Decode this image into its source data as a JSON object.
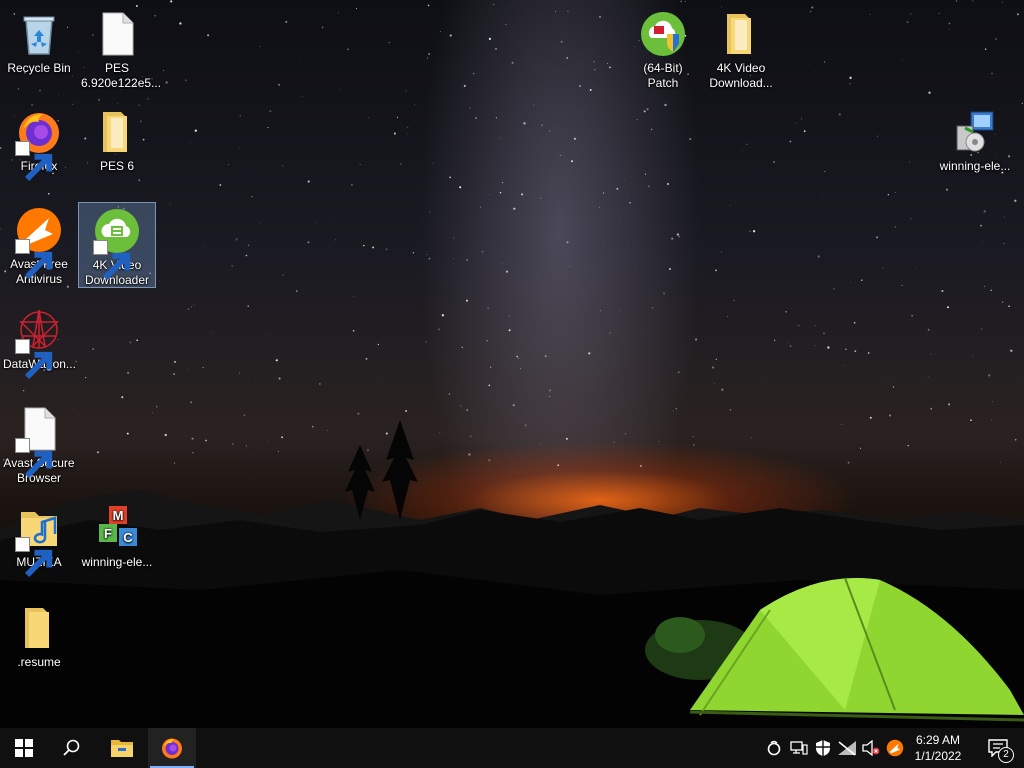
{
  "desktop": {
    "icons": [
      {
        "id": "recycle-bin",
        "label": "Recycle Bin",
        "icon": "recycle-bin-icon"
      },
      {
        "id": "pes-file",
        "label": "PES 6.920e122e5...",
        "icon": "blank-file-icon"
      },
      {
        "id": "firefox",
        "label": "Firefox",
        "icon": "firefox-icon"
      },
      {
        "id": "pes6-folder",
        "label": "PES 6",
        "icon": "folder-icon"
      },
      {
        "id": "avast-antivirus",
        "label": "Avast Free Antivirus",
        "icon": "avast-icon"
      },
      {
        "id": "4k-downloader",
        "label": "4K Video Downloader",
        "icon": "4k-downloader-icon",
        "selected": true
      },
      {
        "id": "datawagon",
        "label": "DataWagon...",
        "icon": "datawagon-icon"
      },
      {
        "id": "avast-browser",
        "label": "Avast Secure Browser",
        "icon": "blank-file-icon"
      },
      {
        "id": "muzika",
        "label": "MUZIKA",
        "icon": "music-folder-icon"
      },
      {
        "id": "winning-eleven-1",
        "label": "winning-ele...",
        "icon": "mfc-blocks-icon"
      },
      {
        "id": "resume",
        "label": ".resume",
        "icon": "folder-icon"
      },
      {
        "id": "patch-64bit",
        "label": "(64-Bit) Patch",
        "icon": "patch-icon"
      },
      {
        "id": "4k-folder",
        "label": "4K Video Download...",
        "icon": "folder-icon"
      },
      {
        "id": "winning-eleven-2",
        "label": "winning-ele...",
        "icon": "installer-icon"
      }
    ]
  },
  "taskbar": {
    "start": "windows-start-icon",
    "search": "search-icon",
    "pinned": [
      {
        "id": "file-explorer",
        "icon": "file-explorer-icon"
      },
      {
        "id": "firefox",
        "icon": "firefox-icon",
        "active": true
      }
    ],
    "tray": [
      "cortana-ring-icon",
      "network-icon",
      "security-shield-icon",
      "wifi-off-icon",
      "volume-muted-icon",
      "avast-tray-icon"
    ],
    "clock": {
      "time": "6:29 AM",
      "date": "1/1/2022"
    },
    "notifications": {
      "count": "2"
    }
  },
  "colors": {
    "taskbar": "#101010",
    "selection": "#7fb0ff",
    "tent": "#8fd630",
    "horizon": "#ff6e14"
  }
}
